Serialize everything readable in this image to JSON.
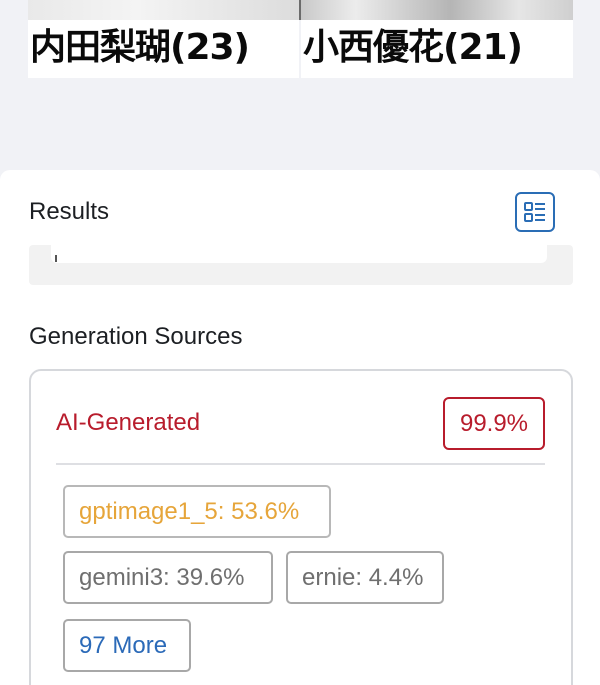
{
  "photo": {
    "left_caption": "内田梨瑚(23)",
    "right_caption": "小西優花(21)"
  },
  "results": {
    "title": "Results"
  },
  "sources": {
    "title": "Generation Sources",
    "ai_label": "AI-Generated",
    "ai_percent": "99.9%",
    "top_model": "gptimage1_5: 53.6%",
    "models": [
      "gemini3: 39.6%",
      "ernie: 4.4%"
    ],
    "more_label": "97 More"
  },
  "colors": {
    "ai_red": "#b81c2c",
    "top_model_orange": "#e6a53a",
    "link_blue": "#2b6ab8",
    "icon_blue": "#2a6db5"
  },
  "icons": {
    "list_toggle": "list-view-icon"
  }
}
